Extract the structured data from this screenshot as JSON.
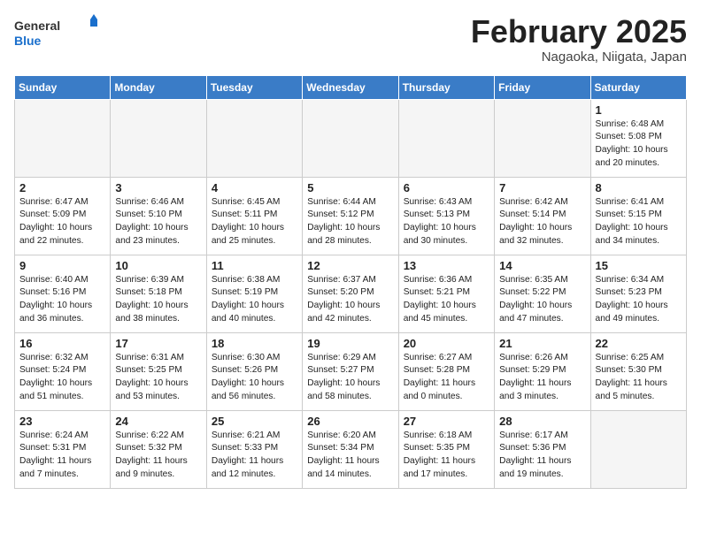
{
  "header": {
    "logo_general": "General",
    "logo_blue": "Blue",
    "month_title": "February 2025",
    "location": "Nagaoka, Niigata, Japan"
  },
  "days_of_week": [
    "Sunday",
    "Monday",
    "Tuesday",
    "Wednesday",
    "Thursday",
    "Friday",
    "Saturday"
  ],
  "weeks": [
    [
      {
        "day": "",
        "info": ""
      },
      {
        "day": "",
        "info": ""
      },
      {
        "day": "",
        "info": ""
      },
      {
        "day": "",
        "info": ""
      },
      {
        "day": "",
        "info": ""
      },
      {
        "day": "",
        "info": ""
      },
      {
        "day": "1",
        "info": "Sunrise: 6:48 AM\nSunset: 5:08 PM\nDaylight: 10 hours\nand 20 minutes."
      }
    ],
    [
      {
        "day": "2",
        "info": "Sunrise: 6:47 AM\nSunset: 5:09 PM\nDaylight: 10 hours\nand 22 minutes."
      },
      {
        "day": "3",
        "info": "Sunrise: 6:46 AM\nSunset: 5:10 PM\nDaylight: 10 hours\nand 23 minutes."
      },
      {
        "day": "4",
        "info": "Sunrise: 6:45 AM\nSunset: 5:11 PM\nDaylight: 10 hours\nand 25 minutes."
      },
      {
        "day": "5",
        "info": "Sunrise: 6:44 AM\nSunset: 5:12 PM\nDaylight: 10 hours\nand 28 minutes."
      },
      {
        "day": "6",
        "info": "Sunrise: 6:43 AM\nSunset: 5:13 PM\nDaylight: 10 hours\nand 30 minutes."
      },
      {
        "day": "7",
        "info": "Sunrise: 6:42 AM\nSunset: 5:14 PM\nDaylight: 10 hours\nand 32 minutes."
      },
      {
        "day": "8",
        "info": "Sunrise: 6:41 AM\nSunset: 5:15 PM\nDaylight: 10 hours\nand 34 minutes."
      }
    ],
    [
      {
        "day": "9",
        "info": "Sunrise: 6:40 AM\nSunset: 5:16 PM\nDaylight: 10 hours\nand 36 minutes."
      },
      {
        "day": "10",
        "info": "Sunrise: 6:39 AM\nSunset: 5:18 PM\nDaylight: 10 hours\nand 38 minutes."
      },
      {
        "day": "11",
        "info": "Sunrise: 6:38 AM\nSunset: 5:19 PM\nDaylight: 10 hours\nand 40 minutes."
      },
      {
        "day": "12",
        "info": "Sunrise: 6:37 AM\nSunset: 5:20 PM\nDaylight: 10 hours\nand 42 minutes."
      },
      {
        "day": "13",
        "info": "Sunrise: 6:36 AM\nSunset: 5:21 PM\nDaylight: 10 hours\nand 45 minutes."
      },
      {
        "day": "14",
        "info": "Sunrise: 6:35 AM\nSunset: 5:22 PM\nDaylight: 10 hours\nand 47 minutes."
      },
      {
        "day": "15",
        "info": "Sunrise: 6:34 AM\nSunset: 5:23 PM\nDaylight: 10 hours\nand 49 minutes."
      }
    ],
    [
      {
        "day": "16",
        "info": "Sunrise: 6:32 AM\nSunset: 5:24 PM\nDaylight: 10 hours\nand 51 minutes."
      },
      {
        "day": "17",
        "info": "Sunrise: 6:31 AM\nSunset: 5:25 PM\nDaylight: 10 hours\nand 53 minutes."
      },
      {
        "day": "18",
        "info": "Sunrise: 6:30 AM\nSunset: 5:26 PM\nDaylight: 10 hours\nand 56 minutes."
      },
      {
        "day": "19",
        "info": "Sunrise: 6:29 AM\nSunset: 5:27 PM\nDaylight: 10 hours\nand 58 minutes."
      },
      {
        "day": "20",
        "info": "Sunrise: 6:27 AM\nSunset: 5:28 PM\nDaylight: 11 hours\nand 0 minutes."
      },
      {
        "day": "21",
        "info": "Sunrise: 6:26 AM\nSunset: 5:29 PM\nDaylight: 11 hours\nand 3 minutes."
      },
      {
        "day": "22",
        "info": "Sunrise: 6:25 AM\nSunset: 5:30 PM\nDaylight: 11 hours\nand 5 minutes."
      }
    ],
    [
      {
        "day": "23",
        "info": "Sunrise: 6:24 AM\nSunset: 5:31 PM\nDaylight: 11 hours\nand 7 minutes."
      },
      {
        "day": "24",
        "info": "Sunrise: 6:22 AM\nSunset: 5:32 PM\nDaylight: 11 hours\nand 9 minutes."
      },
      {
        "day": "25",
        "info": "Sunrise: 6:21 AM\nSunset: 5:33 PM\nDaylight: 11 hours\nand 12 minutes."
      },
      {
        "day": "26",
        "info": "Sunrise: 6:20 AM\nSunset: 5:34 PM\nDaylight: 11 hours\nand 14 minutes."
      },
      {
        "day": "27",
        "info": "Sunrise: 6:18 AM\nSunset: 5:35 PM\nDaylight: 11 hours\nand 17 minutes."
      },
      {
        "day": "28",
        "info": "Sunrise: 6:17 AM\nSunset: 5:36 PM\nDaylight: 11 hours\nand 19 minutes."
      },
      {
        "day": "",
        "info": ""
      }
    ]
  ]
}
